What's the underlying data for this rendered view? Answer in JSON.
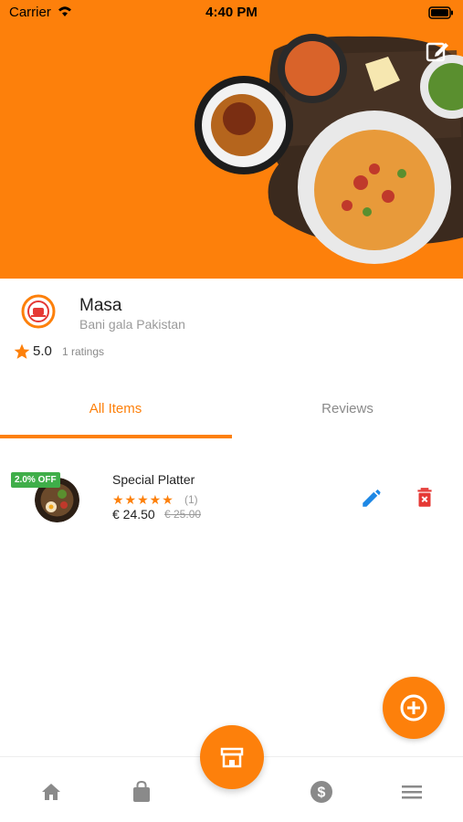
{
  "status_bar": {
    "carrier": "Carrier",
    "time": "4:40 PM"
  },
  "restaurant": {
    "name": "Masa",
    "location": "Bani gala Pakistan",
    "rating": "5.0",
    "ratings_count": "1 ratings"
  },
  "tabs": [
    {
      "label": "All Items",
      "active": true
    },
    {
      "label": "Reviews",
      "active": false
    }
  ],
  "items": [
    {
      "discount_badge": "2.0% OFF",
      "name": "Special Platter",
      "stars": "★★★★★",
      "reviews": "(1)",
      "price": "€ 24.50",
      "old_price": "€ 25.00"
    }
  ],
  "colors": {
    "accent": "#fd800b",
    "discount": "#3fae49",
    "edit_blue": "#1e88e5",
    "delete_red": "#e53935"
  },
  "icons": {
    "banner_edit": "edit-square-icon",
    "item_edit": "pencil-icon",
    "item_delete": "trash-icon",
    "fab": "plus-circle-icon",
    "nav": [
      "home-icon",
      "shopping-bag-icon",
      "store-icon",
      "dollar-icon",
      "menu-icon"
    ]
  }
}
